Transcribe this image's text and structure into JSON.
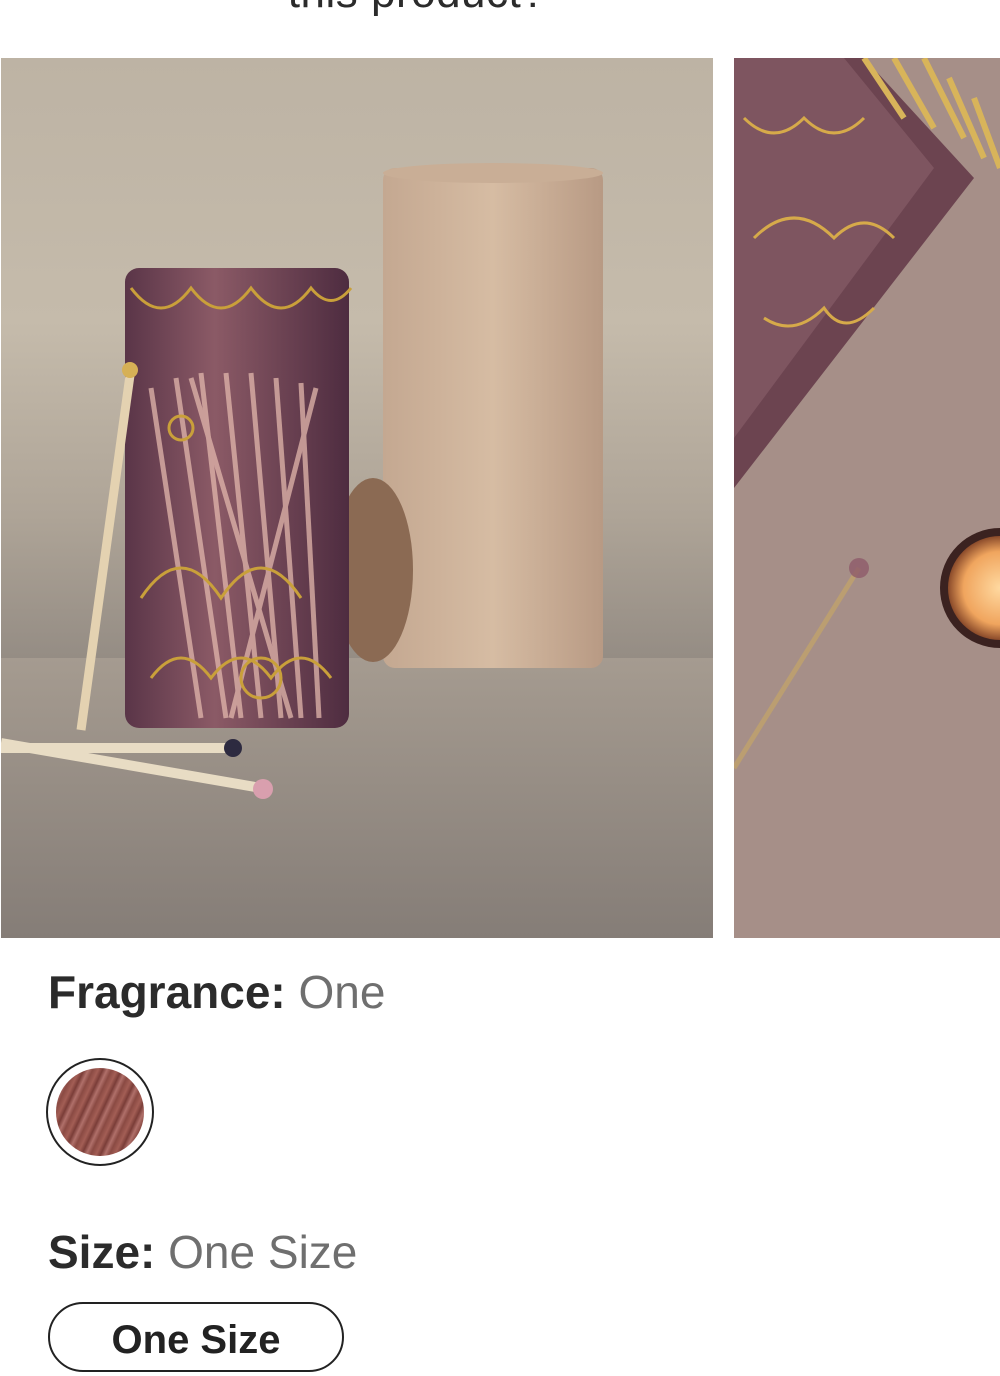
{
  "header": {
    "heading": "this product?"
  },
  "gallery": {
    "images": [
      {
        "alt": "product image 1",
        "icon": "matches-jar-image"
      },
      {
        "alt": "product image 2",
        "icon": "matches-candle-image"
      }
    ]
  },
  "options": {
    "fragrance": {
      "label": "Fragrance:",
      "value": "One",
      "swatches": [
        {
          "name": "One",
          "selected": true
        }
      ]
    },
    "size": {
      "label": "Size:",
      "value": "One Size",
      "buttons": [
        {
          "label": "One Size",
          "selected": true
        }
      ]
    }
  },
  "colors": {
    "text": "#2b2b2b",
    "value_text": "#6f6f6f",
    "border": "#222222"
  }
}
